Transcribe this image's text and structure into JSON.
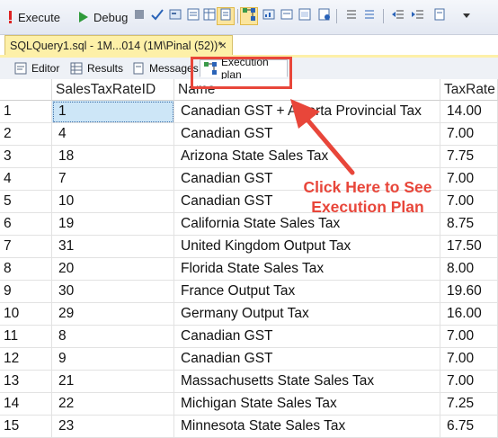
{
  "toolbar": {
    "execute_label": "Execute",
    "debug_label": "Debug",
    "icons": [
      "execute-icon",
      "debug-icon",
      "stop-icon",
      "parse-icon",
      "query-options-icon",
      "results-to-text-icon",
      "results-to-grid-icon",
      "results-to-file-icon",
      "include-plan-icon",
      "comment-icon",
      "uncomment-icon",
      "indent-icon",
      "outdent-icon",
      "dropdown-icon"
    ]
  },
  "document_tab": {
    "title": "SQLQuery1.sql - 1M...014 (1M\\Pinal (52))*",
    "close": "×"
  },
  "result_tabs": [
    {
      "label": "Editor",
      "icon": "editor-icon"
    },
    {
      "label": "Results",
      "icon": "grid-icon"
    },
    {
      "label": "Messages",
      "icon": "messages-icon"
    },
    {
      "label": "Execution plan",
      "icon": "execution-plan-icon"
    }
  ],
  "grid": {
    "columns": [
      "",
      "SalesTaxRateID",
      "Name",
      "TaxRate"
    ],
    "rows": [
      [
        "1",
        "1",
        "Canadian GST + Alberta Provincial Tax",
        "14.00"
      ],
      [
        "2",
        "4",
        "Canadian GST",
        "7.00"
      ],
      [
        "3",
        "18",
        "Arizona State Sales Tax",
        "7.75"
      ],
      [
        "4",
        "7",
        "Canadian GST",
        "7.00"
      ],
      [
        "5",
        "10",
        "Canadian GST",
        "7.00"
      ],
      [
        "6",
        "19",
        "California State Sales Tax",
        "8.75"
      ],
      [
        "7",
        "31",
        "United Kingdom Output Tax",
        "17.50"
      ],
      [
        "8",
        "20",
        "Florida State Sales Tax",
        "8.00"
      ],
      [
        "9",
        "30",
        "France Output Tax",
        "19.60"
      ],
      [
        "10",
        "29",
        "Germany Output Tax",
        "16.00"
      ],
      [
        "11",
        "8",
        "Canadian GST",
        "7.00"
      ],
      [
        "12",
        "9",
        "Canadian GST",
        "7.00"
      ],
      [
        "13",
        "21",
        "Massachusetts State Sales Tax",
        "7.00"
      ],
      [
        "14",
        "22",
        "Michigan State Sales Tax",
        "7.25"
      ],
      [
        "15",
        "23",
        "Minnesota State Sales Tax",
        "6.75"
      ]
    ]
  },
  "annotation": {
    "line1": "Click Here to See",
    "line2": "Execution Plan",
    "color": "#e8463a"
  }
}
